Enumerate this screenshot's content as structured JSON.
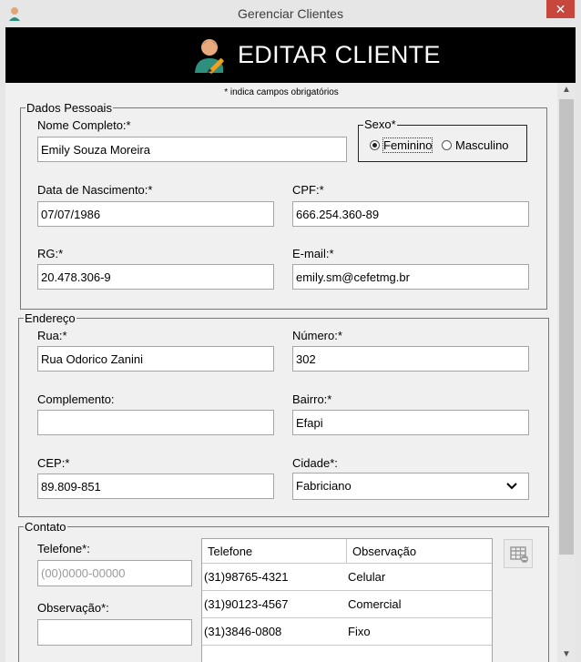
{
  "window": {
    "title": "Gerenciar Clientes",
    "close_glyph": "✕",
    "icon": "user-icon"
  },
  "header": {
    "title": "EDITAR CLIENTE",
    "icon": "person-edit-icon"
  },
  "note": "* indica campos obrigatórios",
  "dados_pessoais": {
    "legend": "Dados Pessoais",
    "nome": {
      "label": "Nome Completo:*",
      "value": "Emily Souza Moreira"
    },
    "sexo": {
      "legend": "Sexo*",
      "options": [
        "Feminino",
        "Masculino"
      ],
      "selected": "Feminino"
    },
    "nascimento": {
      "label": "Data de Nascimento:*",
      "value": "07/07/1986"
    },
    "cpf": {
      "label": "CPF:*",
      "value": "666.254.360-89"
    },
    "rg": {
      "label": "RG:*",
      "value": "20.478.306-9"
    },
    "email": {
      "label": "E-mail:*",
      "value": "emily.sm@cefetmg.br"
    }
  },
  "endereco": {
    "legend": "Endereço",
    "rua": {
      "label": "Rua:*",
      "value": "Rua Odorico Zanini"
    },
    "numero": {
      "label": "Número:*",
      "value": "302"
    },
    "complemento": {
      "label": "Complemento:",
      "value": ""
    },
    "bairro": {
      "label": "Bairro:*",
      "value": "Efapi"
    },
    "cep": {
      "label": "CEP:*",
      "value": "89.809-851"
    },
    "cidade": {
      "label": "Cidade*:",
      "value": "Fabriciano"
    }
  },
  "contato": {
    "legend": "Contato",
    "telefone": {
      "label": "Telefone*:",
      "placeholder": "(00)0000-00000"
    },
    "observacao": {
      "label": "Observação*:",
      "value": ""
    },
    "table": {
      "headers": [
        "Telefone",
        "Observação"
      ],
      "rows": [
        {
          "telefone": "(31)98765-4321",
          "obs": "Celular"
        },
        {
          "telefone": "(31)90123-4567",
          "obs": "Comercial"
        },
        {
          "telefone": "(31)3846-0808",
          "obs": "Fixo"
        }
      ]
    },
    "table_button_icon": "table-remove-icon"
  },
  "colors": {
    "header_bg": "#000000",
    "close_bg": "#c7463e",
    "panel_bg": "#f0f0f0"
  }
}
